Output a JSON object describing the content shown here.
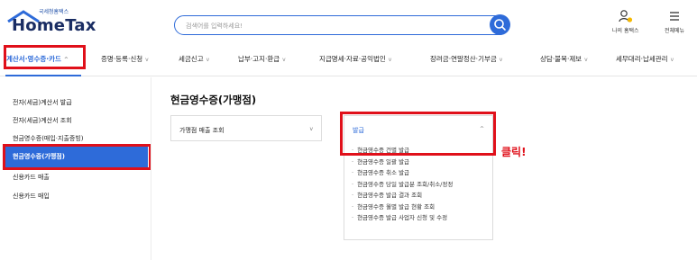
{
  "header": {
    "logo_sub": "국세청홈택스",
    "logo_title": "HomeTax",
    "search_placeholder": "검색어를 입력하세요!",
    "my_hometax": "나의 홈택스",
    "all_menu": "전체메뉴"
  },
  "nav": {
    "items": [
      {
        "label": "계산서·영수증·카드"
      },
      {
        "label": "증명·등록·신청"
      },
      {
        "label": "세금신고"
      },
      {
        "label": "납부·고지·환급"
      },
      {
        "label": "지급명세·자료·공익법인"
      },
      {
        "label": "장려금·연말정산·기부금"
      },
      {
        "label": "상담·불복·제보"
      },
      {
        "label": "세무대리·납세관리"
      }
    ]
  },
  "sidebar": {
    "items": [
      {
        "label": "전자(세금)계산서 발급"
      },
      {
        "label": "전자(세금)계산서 조회"
      },
      {
        "label": "현금영수증(매입·지출증빙)"
      },
      {
        "label": "현금영수증(가맹점)"
      },
      {
        "label": "신용카드 매출"
      },
      {
        "label": "신용카드 매입"
      }
    ]
  },
  "main": {
    "title": "현금영수증(가맹점)",
    "card1_title": "가맹점 매출 조회",
    "card2_title": "발급",
    "menu_items": [
      "현금영수증 건별 발급",
      "현금영수증 일괄 발급",
      "현금영수증 취소 발급",
      "현금영수증 당일 발급분 조회/취소/정정",
      "현금영수증 발급 결과 조회",
      "현금영수증 월별 발급 현황 조회",
      "현금영수증 발급 사업자 신청 및 수정"
    ]
  },
  "annotation": {
    "callout": "클릭!"
  },
  "colors": {
    "accent": "#2e6bd9",
    "highlight": "#e0101a",
    "brand": "#1a2d63"
  },
  "icons": {
    "search": "search-icon",
    "person": "person-icon",
    "menu": "hamburger-icon",
    "chevron": "chevron-down-icon"
  }
}
